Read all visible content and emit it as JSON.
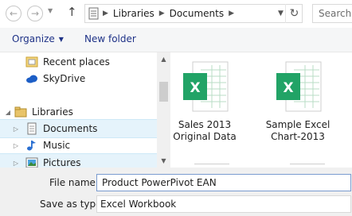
{
  "address_bar": {
    "back_icon": "arrow-left",
    "forward_icon": "arrow-right",
    "crumbs": [
      "Libraries",
      "Documents"
    ],
    "search_placeholder": "Search Documents"
  },
  "toolbar": {
    "organize_label": "Organize",
    "new_folder_label": "New folder"
  },
  "nav": {
    "items": [
      {
        "label": "Recent places",
        "icon": "recent-places-icon"
      },
      {
        "label": "SkyDrive",
        "icon": "cloud-icon"
      },
      {
        "label": "Libraries",
        "icon": "libraries-folder-icon"
      },
      {
        "label": "Documents",
        "icon": "documents-icon"
      },
      {
        "label": "Music",
        "icon": "music-icon"
      },
      {
        "label": "Pictures",
        "icon": "pictures-icon"
      }
    ]
  },
  "files": [
    {
      "line1": "Sales 2013",
      "line2": "Original Data",
      "icon": "excel-file-icon"
    },
    {
      "line1": "Sample Excel",
      "line2": "Chart-2013",
      "icon": "excel-file-icon"
    }
  ],
  "bottom": {
    "file_name_label": "File name:",
    "file_name_value": "Product PowerPivot EAN",
    "save_type_label": "Save as type:",
    "save_type_value": "Excel Workbook"
  },
  "colors": {
    "excel_green": "#21a366",
    "accent_blue": "#1e3287",
    "selection": "#e5f3fb"
  }
}
